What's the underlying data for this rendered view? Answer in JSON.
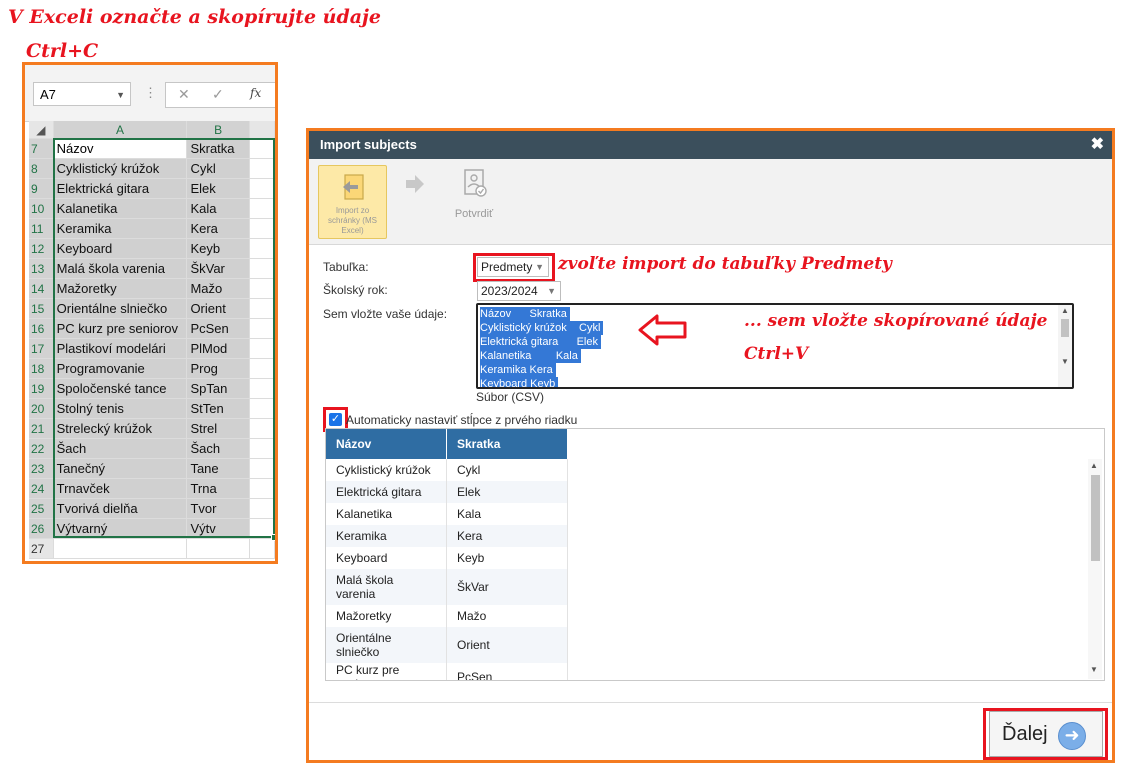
{
  "annotations": {
    "line1": "V Exceli označte  a skopírujte údaje",
    "line2": "Ctrl+C",
    "import_table": "zvoľte import do tabuľky Predmety",
    "paste_here": "... sem vložte skopírované údaje",
    "paste_shortcut": "Ctrl+V"
  },
  "excel": {
    "name_box": "A7",
    "fx": "fx",
    "columns": [
      "A",
      "B"
    ],
    "rows": [
      {
        "n": "7",
        "a": "Názov",
        "b": "Skratka"
      },
      {
        "n": "8",
        "a": "Cyklistický krúžok",
        "b": "Cykl"
      },
      {
        "n": "9",
        "a": "Elektrická gitara",
        "b": "Elek"
      },
      {
        "n": "10",
        "a": "Kalanetika",
        "b": "Kala"
      },
      {
        "n": "11",
        "a": "Keramika",
        "b": "Kera"
      },
      {
        "n": "12",
        "a": "Keyboard",
        "b": "Keyb"
      },
      {
        "n": "13",
        "a": "Malá škola varenia",
        "b": "ŠkVar"
      },
      {
        "n": "14",
        "a": "Mažoretky",
        "b": "Mažo"
      },
      {
        "n": "15",
        "a": "Orientálne slniečko",
        "b": "Orient"
      },
      {
        "n": "16",
        "a": "PC kurz pre seniorov",
        "b": "PcSen"
      },
      {
        "n": "17",
        "a": "Plastikoví modelári",
        "b": "PlMod"
      },
      {
        "n": "18",
        "a": "Programovanie",
        "b": "Prog"
      },
      {
        "n": "19",
        "a": "Spoločenské tance",
        "b": "SpTan"
      },
      {
        "n": "20",
        "a": "Stolný tenis",
        "b": "StTen"
      },
      {
        "n": "21",
        "a": "Strelecký krúžok",
        "b": "Strel"
      },
      {
        "n": "22",
        "a": "Šach",
        "b": "Šach"
      },
      {
        "n": "23",
        "a": "Tanečný",
        "b": "Tane"
      },
      {
        "n": "24",
        "a": "Trnavček",
        "b": "Trna"
      },
      {
        "n": "25",
        "a": "Tvorivá dielňa",
        "b": "Tvor"
      },
      {
        "n": "26",
        "a": "Výtvarný",
        "b": "Výtv"
      },
      {
        "n": "27",
        "a": "",
        "b": ""
      }
    ]
  },
  "dialog": {
    "title": "Import subjects",
    "close": "✖",
    "toolbar": {
      "import_label": "Import zo schránky (MS Excel)",
      "confirm_label": "Potvrdiť"
    },
    "table_label": "Tabuľka:",
    "table_value": "Predmety",
    "year_label": "Školský rok:",
    "year_value": "2023/2024",
    "paste_label": "Sem vložte vaše údaje:",
    "paste_lines": [
      "Názov      Skratka ",
      "Cyklistický krúžok    Cykl ",
      "Elektrická gitara      Elek ",
      "Kalanetika        Kala ",
      "Keramika Kera ",
      "Keyboard Keyb "
    ],
    "file_label": "Súbor (CSV)",
    "auto_columns_label": "Automaticky nastaviť stĺpce z prvého riadku",
    "auto_columns_checked": true,
    "preview": {
      "headers": [
        "Názov",
        "Skratka"
      ],
      "rows": [
        [
          "Cyklistický krúžok",
          "Cykl"
        ],
        [
          "Elektrická gitara",
          "Elek"
        ],
        [
          "Kalanetika",
          "Kala"
        ],
        [
          "Keramika",
          "Kera"
        ],
        [
          "Keyboard",
          "Keyb"
        ],
        [
          "Malá škola varenia",
          "ŠkVar"
        ],
        [
          "Mažoretky",
          "Mažo"
        ],
        [
          "Orientálne slniečko",
          "Orient"
        ],
        [
          "PC kurz pre seniorov",
          "PcSen"
        ]
      ]
    },
    "next_button": "Ďalej"
  },
  "colors": {
    "orange_frame": "#f47b20",
    "red_highlight": "#e8141f",
    "dialog_title_bg": "#3b4f5c",
    "table_header_bg": "#2f6da3",
    "excel_selection": "#217346"
  }
}
